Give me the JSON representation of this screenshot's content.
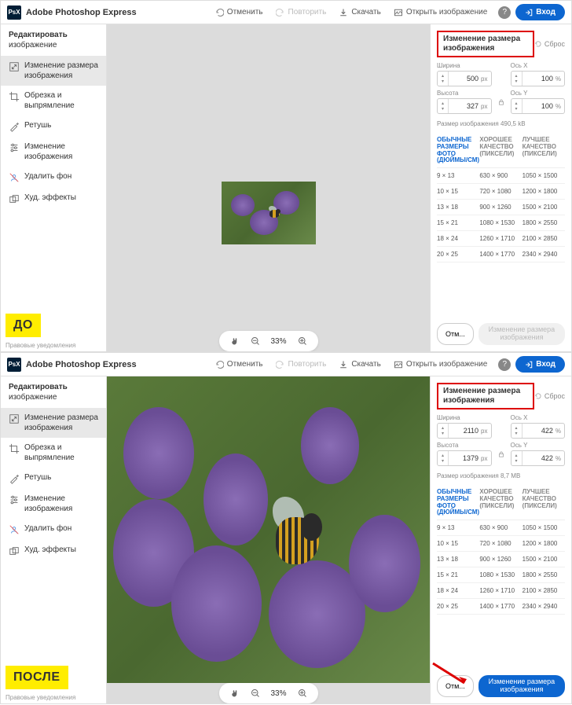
{
  "app_name": "Adobe Photoshop Express",
  "logo_text": "PsX",
  "header": {
    "undo": "Отменить",
    "redo": "Повторить",
    "download": "Скачать",
    "open": "Открыть изображение",
    "login": "Вход"
  },
  "sidebar": {
    "title": "Редактировать",
    "subtitle": "изображение",
    "items": [
      {
        "label": "Изменение размера изображения"
      },
      {
        "label": "Обрезка и выпрямление"
      },
      {
        "label": "Ретушь"
      },
      {
        "label": "Изменение изображения"
      },
      {
        "label": "Удалить фон"
      },
      {
        "label": "Худ. эффекты"
      }
    ],
    "legal": "Правовые уведомления"
  },
  "zoom": "33%",
  "panel": {
    "title": "Изменение размера изображения",
    "reset": "Сброс",
    "width_label": "Ширина",
    "axis_x": "Ось X",
    "height_label": "Высота",
    "axis_y": "Ось Y",
    "px": "px",
    "pct": "%",
    "filesize_label": "Размер изображения",
    "table": {
      "col1a": "ОБЫЧНЫЕ РАЗМЕРЫ ФОТО",
      "col1b": "(ДЮЙМЫ/СМ)",
      "col2": "ХОРОШЕЕ КАЧЕСТВО (ПИКСЕЛИ)",
      "col3": "ЛУЧШЕЕ КАЧЕСТВО (ПИКСЕЛИ)",
      "rows": [
        {
          "s": "9 × 13",
          "g": "630 × 900",
          "b": "1050 × 1500"
        },
        {
          "s": "10 × 15",
          "g": "720 × 1080",
          "b": "1200 × 1800"
        },
        {
          "s": "13 × 18",
          "g": "900 × 1260",
          "b": "1500 × 2100"
        },
        {
          "s": "15 × 21",
          "g": "1080 × 1530",
          "b": "1800 × 2550"
        },
        {
          "s": "18 × 24",
          "g": "1260 × 1710",
          "b": "2100 × 2850"
        },
        {
          "s": "20 × 25",
          "g": "1400 × 1770",
          "b": "2340 × 2940"
        }
      ]
    },
    "cancel": "Отм...",
    "apply": "Изменение размера изображения"
  },
  "before": {
    "badge": "ДО",
    "width": "500",
    "axis_x": "100",
    "height": "327",
    "axis_y": "100",
    "filesize": "490,5 kB"
  },
  "after": {
    "badge": "ПОСЛЕ",
    "width": "2110",
    "axis_x": "422",
    "height": "1379",
    "axis_y": "422",
    "filesize": "8,7 MB"
  }
}
